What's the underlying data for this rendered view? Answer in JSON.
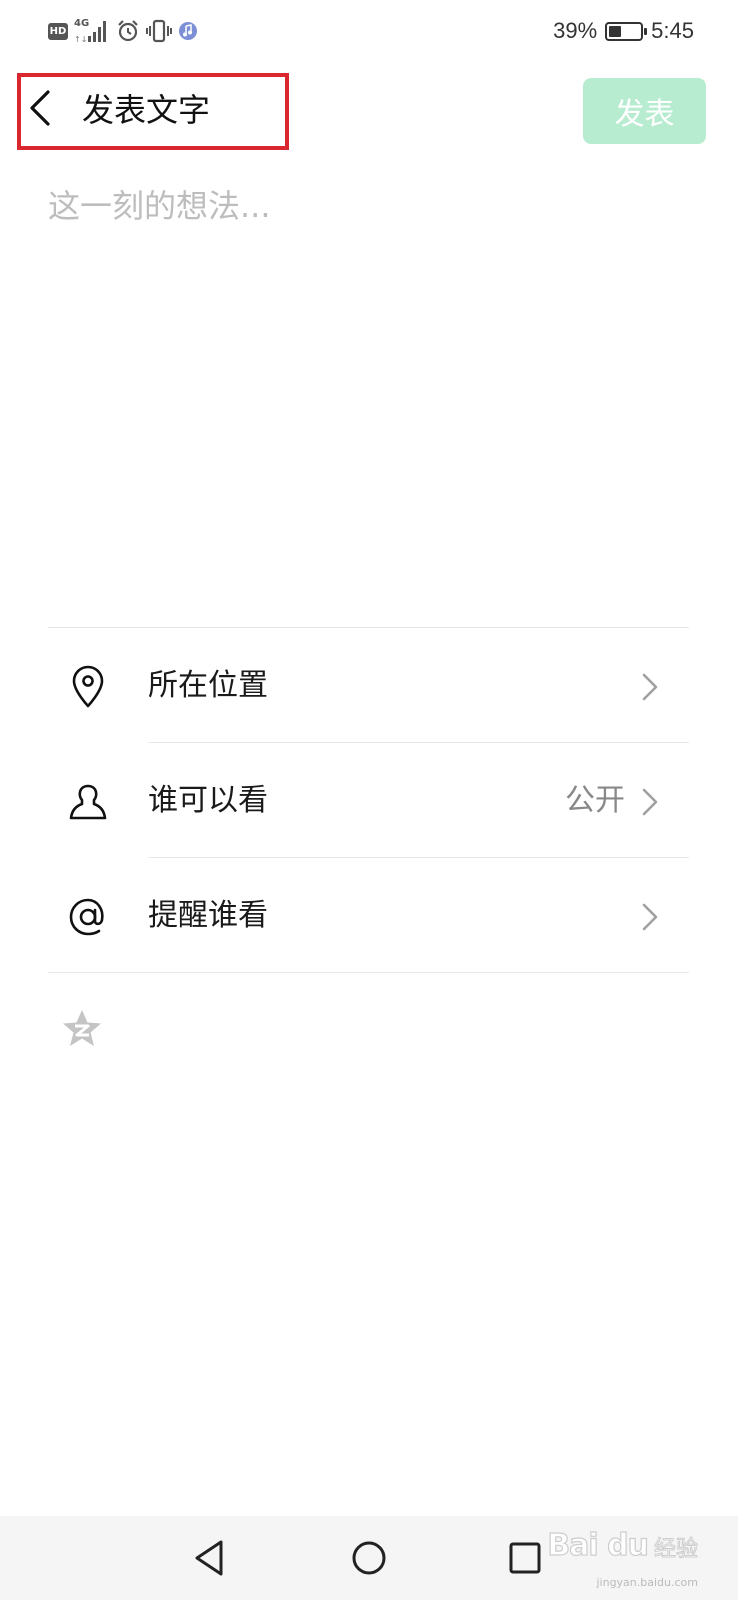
{
  "status_bar": {
    "hd_label": "HD",
    "network_label": "4G",
    "battery_text": "39%",
    "battery_level": 0.39,
    "time": "5:45"
  },
  "header": {
    "title": "发表文字",
    "publish_label": "发表",
    "publish_color": "#b8ecd0",
    "highlight_color": "#d9262f"
  },
  "compose": {
    "placeholder": "这一刻的想法...",
    "value": ""
  },
  "options": [
    {
      "icon": "location-pin-icon",
      "label": "所在位置",
      "value": ""
    },
    {
      "icon": "person-icon",
      "label": "谁可以看",
      "value": "公开"
    },
    {
      "icon": "at-sign-icon",
      "label": "提醒谁看",
      "value": ""
    }
  ],
  "extras": {
    "qzone_icon": "qzone-star-icon"
  },
  "watermark": {
    "brand": "Bai du",
    "suffix": "经验",
    "url": "jingyan.baidu.com"
  }
}
